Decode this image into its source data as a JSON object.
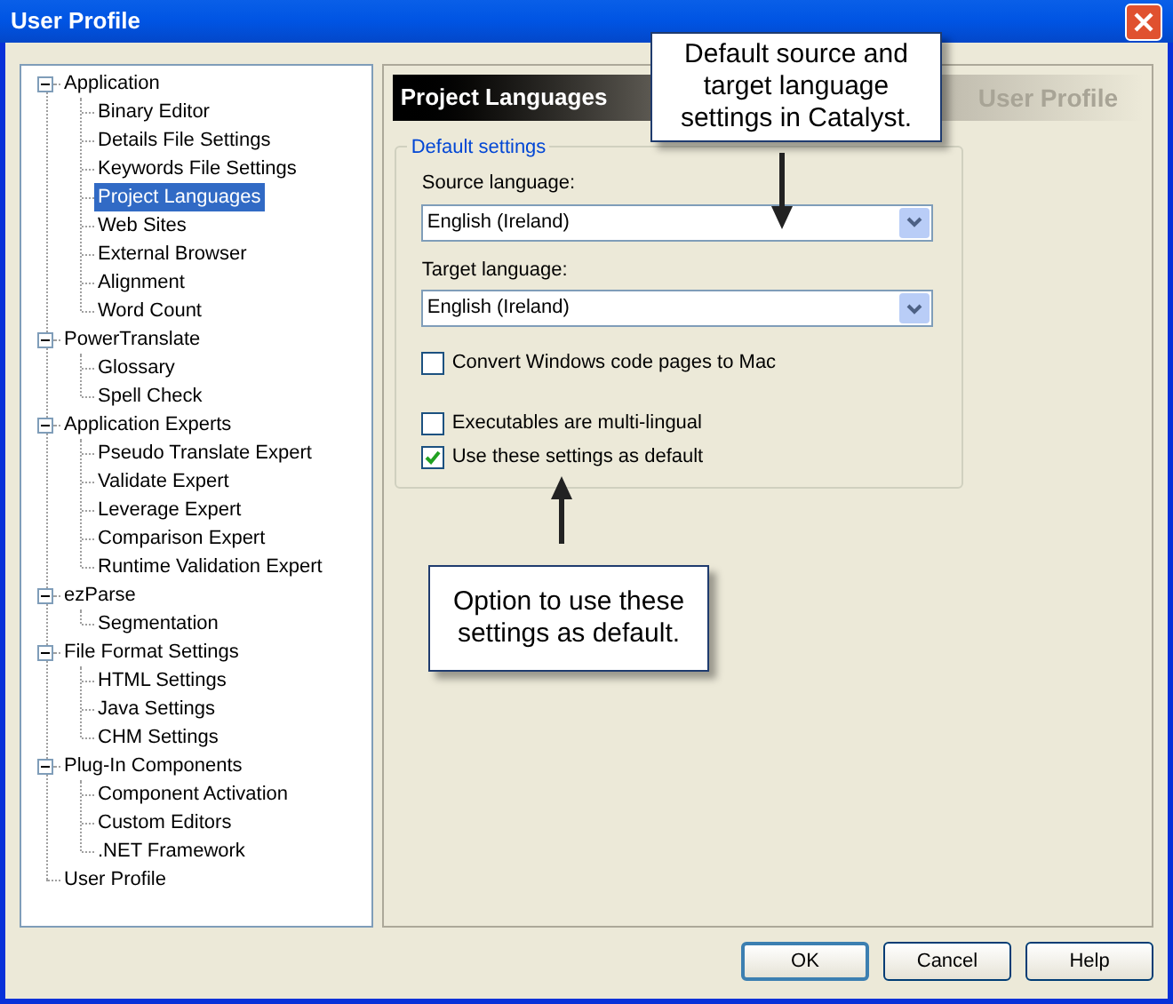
{
  "window": {
    "title": "User Profile"
  },
  "tree": [
    {
      "label": "Application",
      "expanded": true,
      "selected": false,
      "children": [
        {
          "label": "Binary Editor",
          "selected": false
        },
        {
          "label": "Details File Settings",
          "selected": false
        },
        {
          "label": "Keywords File Settings",
          "selected": false
        },
        {
          "label": "Project Languages",
          "selected": true
        },
        {
          "label": "Web Sites",
          "selected": false
        },
        {
          "label": "External Browser",
          "selected": false
        },
        {
          "label": "Alignment",
          "selected": false
        },
        {
          "label": "Word Count",
          "selected": false
        }
      ]
    },
    {
      "label": "PowerTranslate",
      "expanded": true,
      "selected": false,
      "children": [
        {
          "label": "Glossary",
          "selected": false
        },
        {
          "label": "Spell Check",
          "selected": false
        }
      ]
    },
    {
      "label": "Application Experts",
      "expanded": true,
      "selected": false,
      "children": [
        {
          "label": "Pseudo Translate Expert",
          "selected": false
        },
        {
          "label": "Validate Expert",
          "selected": false
        },
        {
          "label": "Leverage Expert",
          "selected": false
        },
        {
          "label": "Comparison Expert",
          "selected": false
        },
        {
          "label": "Runtime Validation Expert",
          "selected": false
        }
      ]
    },
    {
      "label": "ezParse",
      "expanded": true,
      "selected": false,
      "children": [
        {
          "label": "Segmentation",
          "selected": false
        }
      ]
    },
    {
      "label": "File Format Settings",
      "expanded": true,
      "selected": false,
      "children": [
        {
          "label": "HTML Settings",
          "selected": false
        },
        {
          "label": "Java Settings",
          "selected": false
        },
        {
          "label": "CHM Settings",
          "selected": false
        }
      ]
    },
    {
      "label": "Plug-In Components",
      "expanded": true,
      "selected": false,
      "children": [
        {
          "label": "Component Activation",
          "selected": false
        },
        {
          "label": "Custom Editors",
          "selected": false
        },
        {
          "label": ".NET Framework",
          "selected": false
        }
      ]
    },
    {
      "label": "User Profile",
      "selected": false
    }
  ],
  "panel": {
    "title": "Project Languages",
    "watermark": "User Profile",
    "group": {
      "legend": "Default settings",
      "dropdowns": [
        {
          "label": "Source language:",
          "value": "English (Ireland)"
        },
        {
          "label": "Target language:",
          "value": "English (Ireland)"
        }
      ],
      "checkboxes": [
        {
          "label": "Convert Windows code pages to Mac",
          "checked": false
        },
        {
          "label": "Executables are multi-lingual",
          "checked": false
        },
        {
          "label": "Use these settings as default",
          "checked": true
        }
      ]
    }
  },
  "callouts": [
    {
      "text": "Default source and target language settings in Catalyst."
    },
    {
      "text": "Option to use these settings as default."
    }
  ],
  "buttons": [
    {
      "label": "OK",
      "default": true
    },
    {
      "label": "Cancel",
      "default": false
    },
    {
      "label": "Help",
      "default": false
    }
  ]
}
